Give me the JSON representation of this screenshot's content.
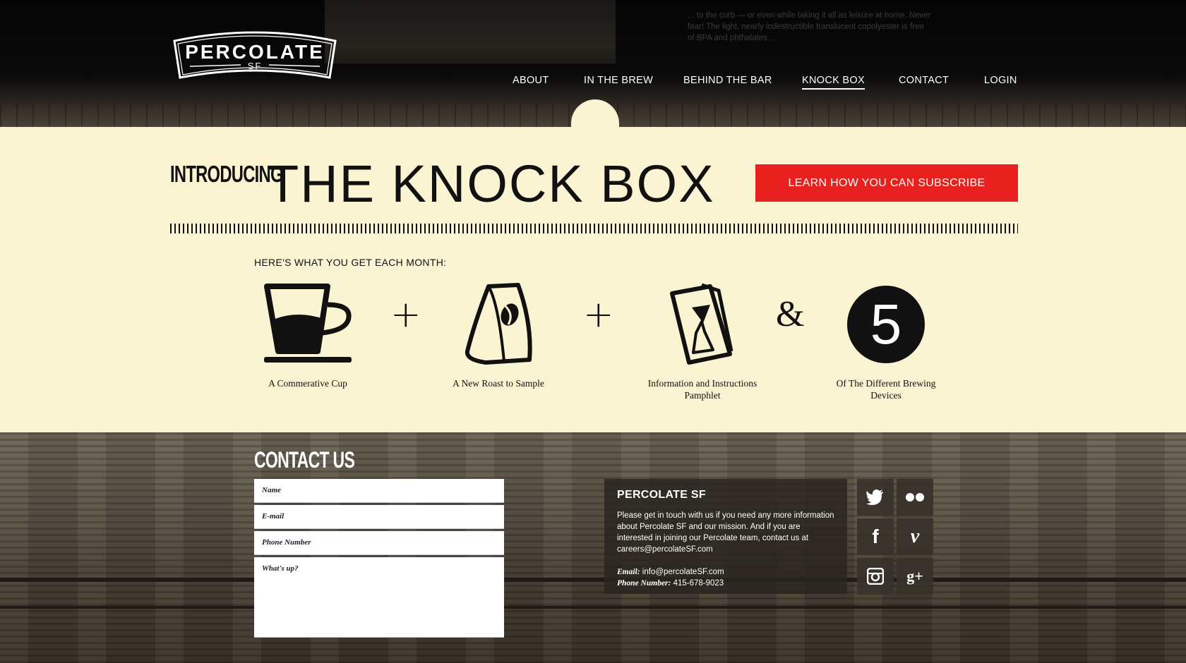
{
  "header": {
    "faded_text": "... to the curb — or even while taking it all as leisure at home. Never fear! The light, nearly indestructible translucent copolyester is free of BPA and phthalates ...",
    "logo": {
      "name": "PERCOLATE",
      "sub": "SF"
    }
  },
  "nav": {
    "items": [
      {
        "label": "ABOUT"
      },
      {
        "label": "IN THE BREW"
      },
      {
        "label": "BEHIND THE BAR"
      },
      {
        "label": "KNOCK BOX",
        "active": true
      },
      {
        "label": "CONTACT"
      },
      {
        "label": "LOGIN"
      }
    ]
  },
  "hero": {
    "introducing": "INTRODUCING",
    "title": "THE KNOCK BOX",
    "cta": "LEARN HOW YOU CAN SUBSCRIBE"
  },
  "monthly": {
    "label": "HERE'S WHAT YOU GET EACH MONTH:",
    "items": [
      {
        "icon": "cup-icon",
        "caption": "A Commerative Cup"
      },
      {
        "icon": "coffee-bag-icon",
        "caption": "A New Roast to Sample"
      },
      {
        "icon": "pamphlet-icon",
        "caption": "Information and Instructions Pamphlet"
      },
      {
        "icon": "number-five-icon",
        "number": "5",
        "caption": "Of The Different Brewing Devices"
      }
    ],
    "operators": [
      "+",
      "+",
      "&"
    ]
  },
  "contact": {
    "title": "CONTACT US",
    "fields": {
      "name": "Name",
      "email": "E-mail",
      "phone": "Phone Number",
      "message": "What's up?"
    }
  },
  "info": {
    "title": "PERCOLATE SF",
    "body": "Please get in touch with us if you need any more information about Percolate SF and our mission. And if you are interested in joining our Percolate team, contact us at careers@percolateSF.com",
    "email_label": "Email:",
    "email": "info@percolateSF.com",
    "phone_label": "Phone Number:",
    "phone": "415-678-9023"
  },
  "social": [
    "twitter-icon",
    "flickr-icon",
    "facebook-icon",
    "vimeo-icon",
    "instagram-icon",
    "google-plus-icon"
  ],
  "colors": {
    "accent": "#e8211f",
    "cream": "#faf4d3",
    "ink": "#111111"
  }
}
